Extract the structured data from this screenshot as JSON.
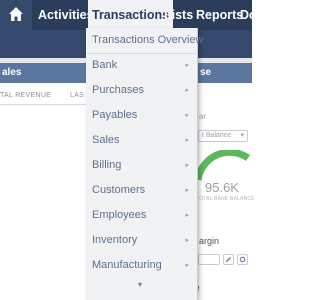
{
  "nav": {
    "items": [
      {
        "label": "Activities",
        "active": false
      },
      {
        "label": "Transactions",
        "active": true
      },
      {
        "label": "Lists",
        "active": false
      },
      {
        "label": "Reports",
        "active": false
      },
      {
        "label": "Do",
        "active": false
      }
    ]
  },
  "transactions_menu": {
    "items": [
      {
        "label": "Transactions Overview",
        "has_submenu": false
      },
      {
        "label": "Bank",
        "has_submenu": true
      },
      {
        "label": "Purchases",
        "has_submenu": true
      },
      {
        "label": "Payables",
        "has_submenu": true
      },
      {
        "label": "Sales",
        "has_submenu": true
      },
      {
        "label": "Billing",
        "has_submenu": true
      },
      {
        "label": "Customers",
        "has_submenu": true
      },
      {
        "label": "Employees",
        "has_submenu": true
      },
      {
        "label": "Inventory",
        "has_submenu": true
      },
      {
        "label": "Manufacturing",
        "has_submenu": true
      }
    ],
    "submenu_arrow": "▸",
    "scroll_arrow": "▾"
  },
  "background": {
    "left_portlet_title": "ales",
    "left_col_1": "TAL REVENUE",
    "left_col_2": "LAS",
    "right_portlet_title": "se",
    "right_text_1": "ar",
    "select_label": "t Balance",
    "select_chevron": "▾",
    "gauge_value": "95.6K",
    "gauge_caption": "TOTAL BANK BALANCE",
    "right_text_2": "argin",
    "bottom_link": "e"
  },
  "colors": {
    "nav_bg": "#2a3e5c",
    "menu_bg": "#f1f2f4",
    "menu_text": "#5d718f",
    "portlet_head": "#5b77a0",
    "gauge_green": "#5cb85c"
  }
}
